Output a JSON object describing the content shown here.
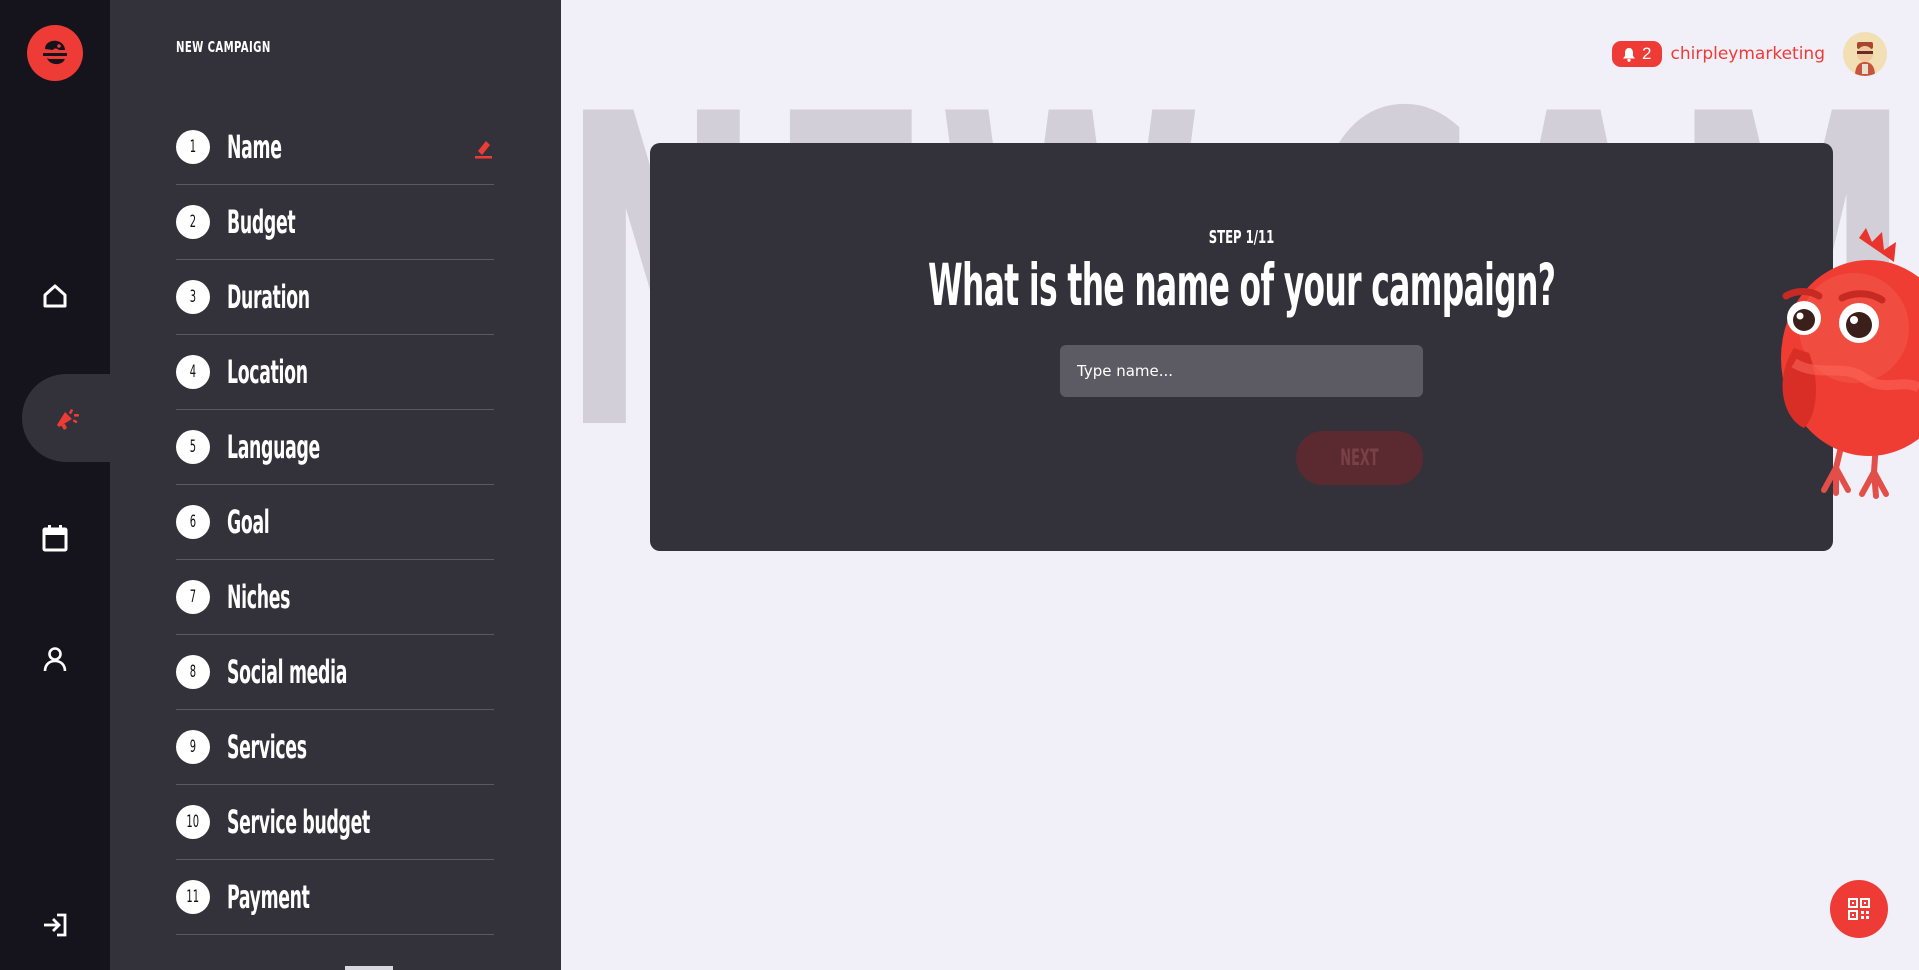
{
  "rail": {
    "items": [
      {
        "name": "home",
        "icon": "home-icon"
      },
      {
        "name": "campaigns",
        "icon": "megaphone-icon",
        "active": true
      },
      {
        "name": "calendar",
        "icon": "calendar-icon"
      },
      {
        "name": "profile",
        "icon": "user-icon"
      },
      {
        "name": "logout",
        "icon": "logout-icon"
      }
    ]
  },
  "steps_panel": {
    "title": "NEW CAMPAIGN",
    "steps": [
      {
        "number": "1",
        "label": "Name",
        "editing": true
      },
      {
        "number": "2",
        "label": "Budget"
      },
      {
        "number": "3",
        "label": "Duration"
      },
      {
        "number": "4",
        "label": "Location"
      },
      {
        "number": "5",
        "label": "Language"
      },
      {
        "number": "6",
        "label": "Goal"
      },
      {
        "number": "7",
        "label": "Niches"
      },
      {
        "number": "8",
        "label": "Social media"
      },
      {
        "number": "9",
        "label": "Services"
      },
      {
        "number": "10",
        "label": "Service budget"
      },
      {
        "number": "11",
        "label": "Payment"
      }
    ]
  },
  "header": {
    "notification_count": "2",
    "username": "chirpleymarketing"
  },
  "main": {
    "watermark": "NEW CAMPAIGN",
    "step_counter": "STEP 1/11",
    "question": "What is the name of your campaign?",
    "name_input": {
      "value": "",
      "placeholder": "Type name..."
    },
    "next_label": "NEXT"
  },
  "colors": {
    "accent": "#ef3b36",
    "rail_bg": "#15141d",
    "panel_bg": "#33323b",
    "page_bg": "#f1eff8",
    "watermark": "#d3cfd9"
  }
}
